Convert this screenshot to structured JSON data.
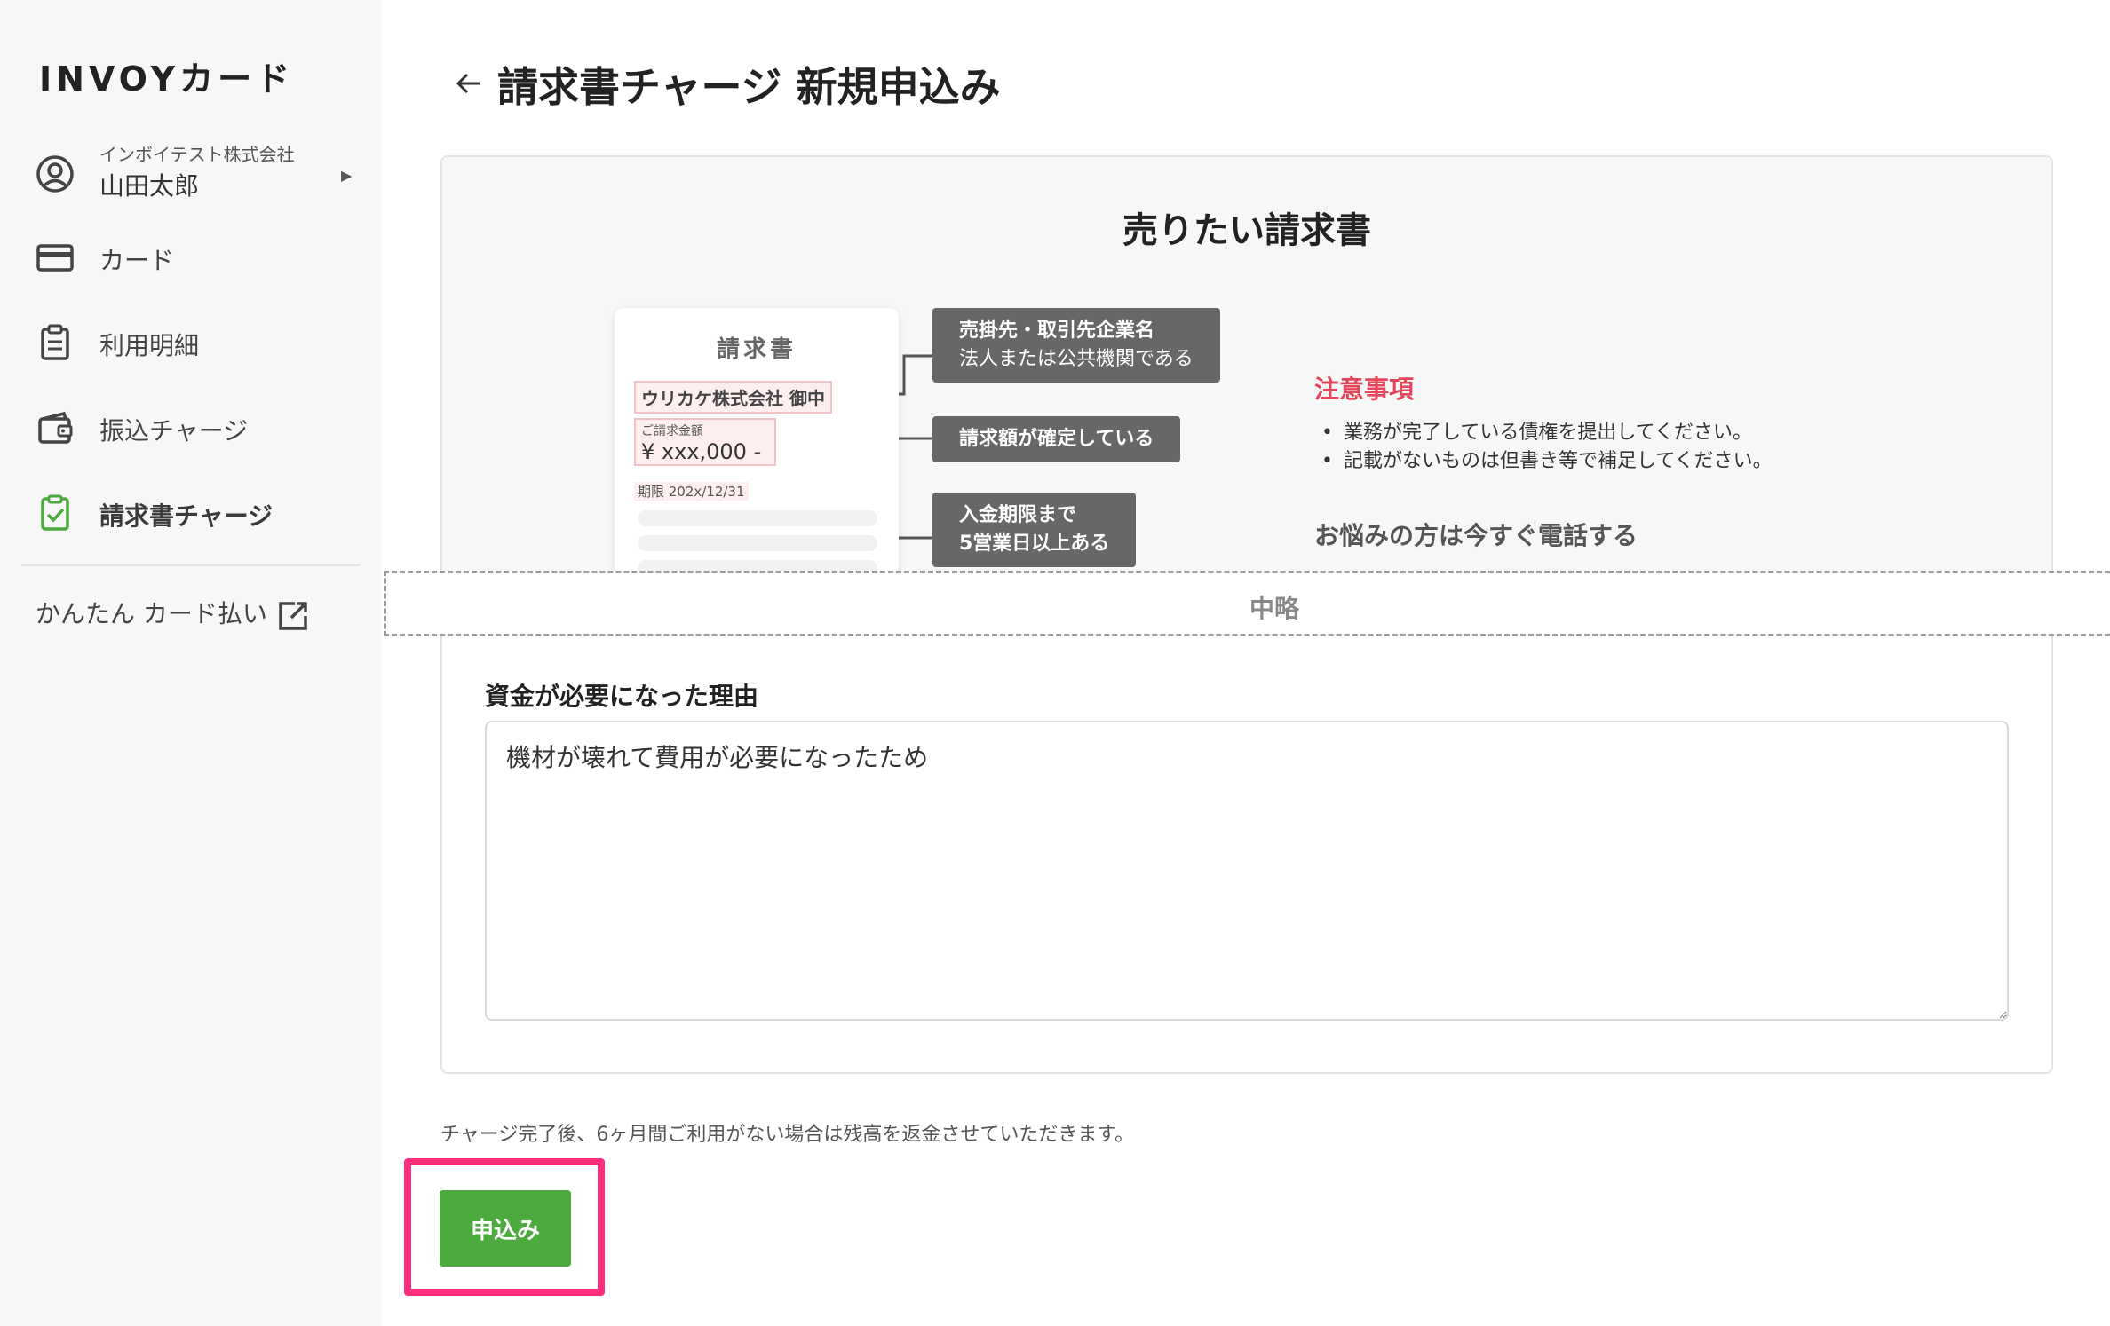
{
  "app": {
    "logo": "INVOYカード"
  },
  "user": {
    "company": "インボイテスト株式会社",
    "name": "山田太郎"
  },
  "sidebar": {
    "items": [
      {
        "label": "カード",
        "icon": "credit-card-icon"
      },
      {
        "label": "利用明細",
        "icon": "clipboard-icon"
      },
      {
        "label": "振込チャージ",
        "icon": "wallet-icon"
      },
      {
        "label": "請求書チャージ",
        "icon": "document-check-icon",
        "active": true
      }
    ],
    "external_link": "かんたん カード払い"
  },
  "header": {
    "title": "請求書チャージ 新規申込み"
  },
  "section": {
    "title": "売りたい請求書"
  },
  "invoice_example": {
    "title": "請求書",
    "client": "ウリカケ株式会社 御中",
    "amount_label": "ご請求金額",
    "amount_value": "¥ xxx,000 -",
    "due": "期限 202x/12/31"
  },
  "callouts": {
    "c1_main": "売掛先・取引先企業名",
    "c1_sub": "法人または公共機関である",
    "c2_main": "請求額が確定している",
    "c3_line1": "入金期限まで",
    "c3_line2": "5営業日以上ある"
  },
  "notes": {
    "title": "注意事項",
    "items": [
      "業務が完了している債権を提出してください。",
      "記載がないものは但書き等で補足してください。"
    ],
    "phone_link": "お悩みの方は今すぐ電話する"
  },
  "omitted_label": "中略",
  "reason_field": {
    "label": "資金が必要になった理由",
    "value": "機材が壊れて費用が必要になったため"
  },
  "notice": "チャージ完了後、6ヶ月間ご利用がない場合は残高を返金させていただきます。",
  "submit_label": "申込み",
  "colors": {
    "accent_green": "#4caa3e",
    "warning_red": "#e5455a",
    "highlight_pink": "#ff2e7a"
  }
}
